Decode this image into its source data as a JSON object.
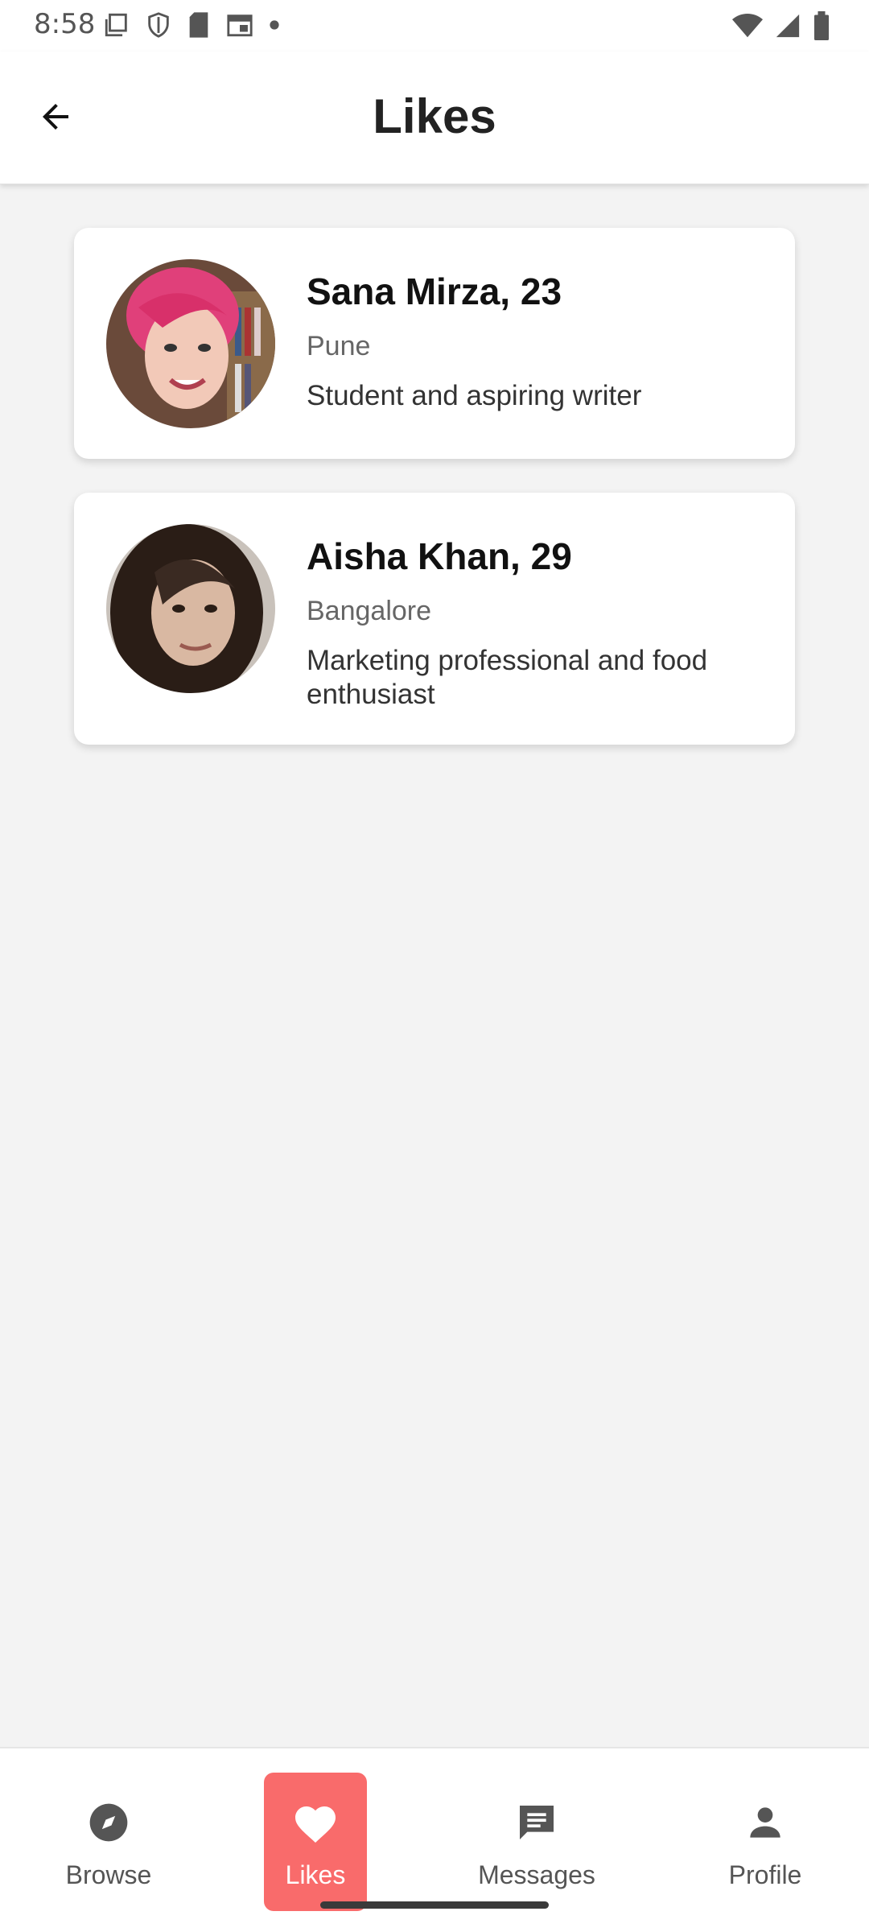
{
  "status_bar": {
    "time": "8:58",
    "left_icons": [
      "screenshot-icon",
      "shield-icon",
      "sd-card-icon",
      "calendar-icon",
      "dot-icon"
    ],
    "right_icons": [
      "wifi-icon",
      "signal-icon",
      "battery-icon"
    ]
  },
  "header": {
    "title": "Likes",
    "back_icon": "arrow-left-icon"
  },
  "likes": [
    {
      "name_age": "Sana Mirza, 23",
      "city": "Pune",
      "bio": "Student and aspiring writer",
      "avatar_desc_colors": [
        "#e0407a",
        "#f2c9b8"
      ]
    },
    {
      "name_age": "Aisha Khan, 29",
      "city": "Bangalore",
      "bio": "Marketing professional and food enthusiast",
      "avatar_desc_colors": [
        "#3a2a22",
        "#d9b8a2"
      ]
    }
  ],
  "bottom_nav": {
    "items": [
      {
        "label": "Browse",
        "icon": "compass-icon",
        "active": false
      },
      {
        "label": "Likes",
        "icon": "heart-icon",
        "active": true
      },
      {
        "label": "Messages",
        "icon": "chat-icon",
        "active": false
      },
      {
        "label": "Profile",
        "icon": "person-icon",
        "active": false
      }
    ],
    "accent": "#f96b6b"
  }
}
